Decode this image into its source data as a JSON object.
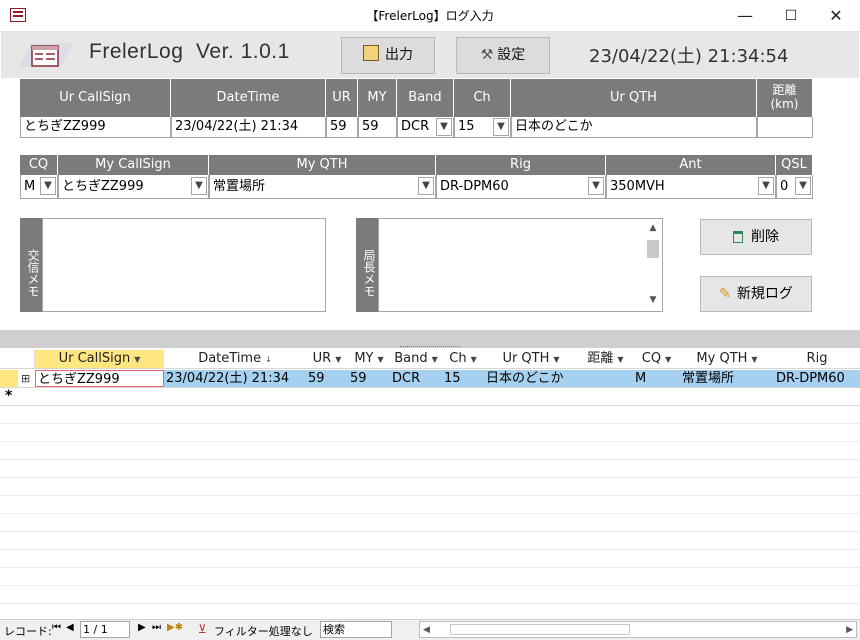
{
  "window": {
    "title": "【FrelerLog】ログ入力",
    "minimize": "—",
    "maximize": "☐",
    "close": "✕"
  },
  "header": {
    "app_name": "FrelerLog  Ver. 1.0.1",
    "output_label": "出力",
    "settings_label": "設定",
    "clock": "23/04/22(土) 21:34:54"
  },
  "entry1": {
    "headers": {
      "ur_callsign": "Ur CallSign",
      "datetime": "DateTime",
      "ur": "UR",
      "my": "MY",
      "band": "Band",
      "ch": "Ch",
      "ur_qth": "Ur QTH",
      "distance": "距離\n(km)"
    },
    "values": {
      "ur_callsign": "とちぎZZ999",
      "datetime": "23/04/22(土) 21:34",
      "ur": "59",
      "my": "59",
      "band": "DCR",
      "ch": "15",
      "ur_qth": "日本のどこか",
      "distance": ""
    }
  },
  "entry2": {
    "headers": {
      "cq": "CQ",
      "my_callsign": "My CallSign",
      "my_qth": "My QTH",
      "rig": "Rig",
      "ant": "Ant",
      "qsl": "QSL"
    },
    "values": {
      "cq": "M",
      "my_callsign": "とちぎZZ999",
      "my_qth": "常置場所",
      "rig": "DR-DPM60",
      "ant": "350MVH",
      "qsl": "0"
    }
  },
  "memo": {
    "exchange_label": "交信メモ",
    "exchange_value": "",
    "station_label": "局長メモ",
    "station_value": ""
  },
  "buttons": {
    "delete_label": "削除",
    "newlog_label": "新規ログ"
  },
  "datasheet": {
    "columns": [
      "Ur CallSign",
      "DateTime",
      "UR",
      "MY",
      "Band",
      "Ch",
      "Ur QTH",
      "距離",
      "CQ",
      "My QTH",
      "Rig"
    ],
    "rows": [
      [
        "とちぎZZ999",
        "23/04/22(土) 21:34",
        "59",
        "59",
        "DCR",
        "15",
        "日本のどこか",
        "",
        "M",
        "常置場所",
        "DR-DPM60"
      ]
    ],
    "new_row_marker": "*",
    "expand_marker": "⊞"
  },
  "statusbar": {
    "record_label": "レコード:",
    "record_position": "1 / 1",
    "filter_label": "フィルター処理なし",
    "search_label": "検索"
  },
  "colors": {
    "header_bg": "#e7e7e7",
    "table_header": "#7b7b7b",
    "selected_row": "#a6d0f0",
    "sort_header": "#ffe680"
  }
}
